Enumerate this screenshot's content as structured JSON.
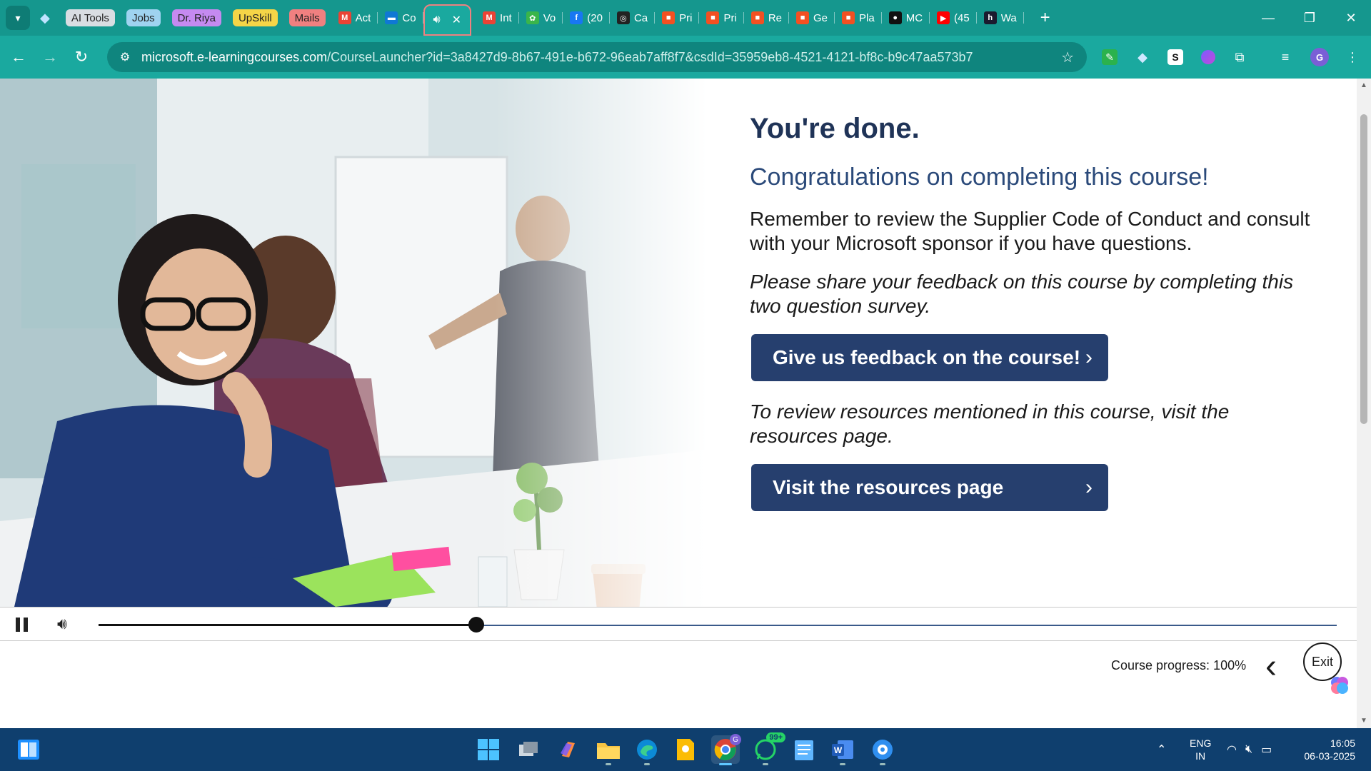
{
  "browser": {
    "tab_groups": [
      {
        "label": "AI Tools",
        "color": "#d9dde2"
      },
      {
        "label": "Jobs",
        "color": "#9fd3f0"
      },
      {
        "label": "Dr. Riya",
        "color": "#c58af0"
      },
      {
        "label": "UpSkill",
        "color": "#f5d547"
      },
      {
        "label": "Mails",
        "color": "#f08080"
      }
    ],
    "tabs_before": [
      {
        "title": "Act",
        "icon": "gmail-icon",
        "color": "#ea4335",
        "glyph": "M"
      },
      {
        "title": "Co",
        "icon": "outlook-icon",
        "color": "#0f78d4",
        "glyph": "▬"
      }
    ],
    "tabs_after": [
      {
        "title": "Int",
        "icon": "gmail-icon",
        "color": "#ea4335",
        "glyph": "M"
      },
      {
        "title": "Vo",
        "icon": "leaf-icon",
        "color": "#3ab54a",
        "glyph": "✿"
      },
      {
        "title": "(20",
        "icon": "facebook-icon",
        "color": "#1877f2",
        "glyph": "f"
      },
      {
        "title": "Ca",
        "icon": "chatgpt-icon",
        "color": "#222",
        "glyph": "◎"
      },
      {
        "title": "Pri",
        "icon": "microsoft-icon",
        "color": "#f25022",
        "glyph": "■"
      },
      {
        "title": "Pri",
        "icon": "microsoft-icon",
        "color": "#f25022",
        "glyph": "■"
      },
      {
        "title": "Re",
        "icon": "microsoft-icon",
        "color": "#f25022",
        "glyph": "■"
      },
      {
        "title": "Ge",
        "icon": "microsoft-icon",
        "color": "#f25022",
        "glyph": "■"
      },
      {
        "title": "Pla",
        "icon": "microsoft-icon",
        "color": "#f25022",
        "glyph": "■"
      },
      {
        "title": "MC",
        "icon": "github-icon",
        "color": "#111",
        "glyph": "●"
      },
      {
        "title": "(45",
        "icon": "youtube-icon",
        "color": "#ff0000",
        "glyph": "▶"
      },
      {
        "title": "Wa",
        "icon": "hackerrank-icon",
        "color": "#1b1b2f",
        "glyph": "h"
      }
    ],
    "active_tab": {
      "audio_icon": "speaker-icon",
      "close": "✕"
    },
    "new_tab": "+",
    "url_host": "microsoft.e-learningcourses.com",
    "url_path": "/CourseLauncher?id=3a8427d9-8b67-491e-b672-96eab7aff8f7&csdId=35959eb8-4521-4121-bf8c-b9c47aa573b7",
    "avatar_letter": "G",
    "ext_s_letter": "S"
  },
  "course": {
    "heading": "You're done.",
    "subheading": "Congratulations on completing this course!",
    "reminder": "Remember to review the Supplier Code of Conduct and consult with your Microsoft sponsor if you have questions.",
    "feedback_prompt": "Please share your feedback on this course by completing this two question survey.",
    "feedback_button": "Give us feedback on the course!",
    "resources_prompt": "To review resources mentioned in this course, visit the resources page.",
    "resources_button": "Visit the resources page",
    "chevron": "›"
  },
  "player": {
    "playback_fraction": 0.305,
    "progress_label": "Course progress: 100%",
    "exit_label": "Exit"
  },
  "taskbar": {
    "whatsapp_badge": "99+",
    "chrome_badge": "G",
    "lang_top": "ENG",
    "lang_bottom": "IN",
    "time": "16:05",
    "date": "06-03-2025"
  },
  "colors": {
    "browser_teal": "#15978e",
    "button_navy": "#263f6e",
    "heading_navy": "#1f3357"
  }
}
